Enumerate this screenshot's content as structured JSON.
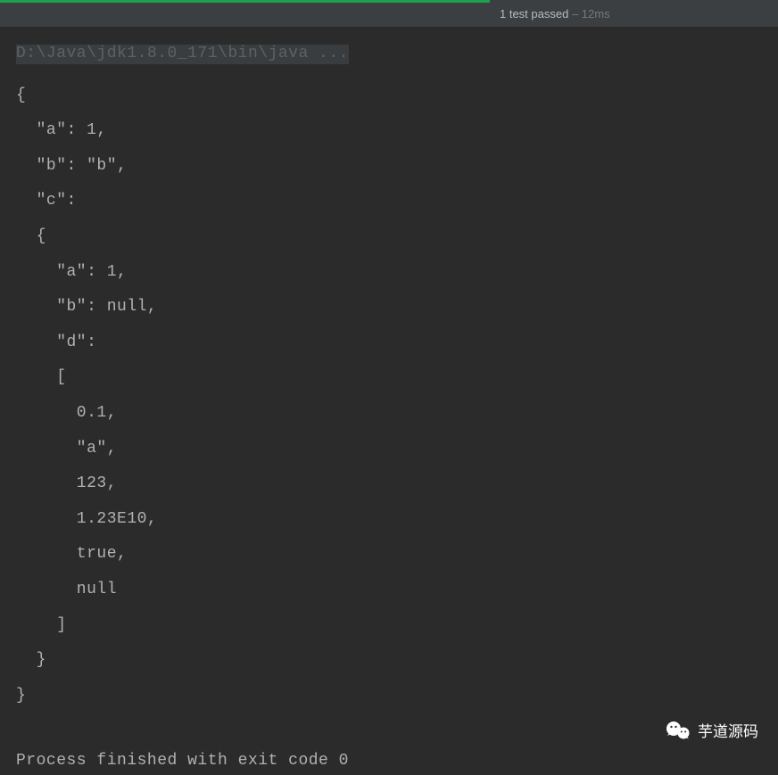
{
  "header": {
    "test_result": "1 test passed",
    "test_time": " – 12ms",
    "progress_color": "#1ea04c"
  },
  "console": {
    "command": "D:\\Java\\jdk1.8.0_171\\bin\\java ...",
    "json_output": "{\n  \"a\": 1,\n  \"b\": \"b\",\n  \"c\":\n  {\n    \"a\": 1,\n    \"b\": null,\n    \"d\":\n    [\n      0.1,\n      \"a\",\n      123,\n      1.23E10,\n      true,\n      null\n    ]\n  }\n}",
    "process_line": "Process finished with exit code 0"
  },
  "watermark": {
    "text": "芋道源码",
    "icon_name": "wechat"
  }
}
